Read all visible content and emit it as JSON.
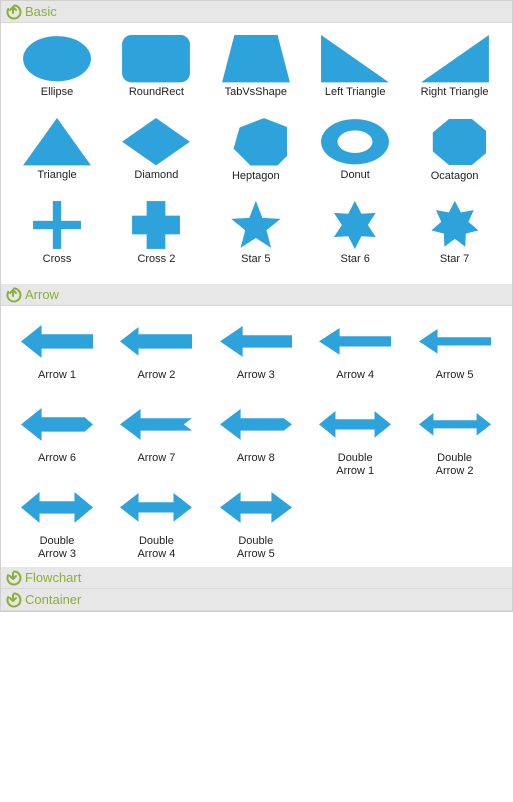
{
  "colors": {
    "shape_fill": "#2ea2da",
    "header_text": "#8bae3a",
    "header_bg": "#e7e7e7"
  },
  "sections": [
    {
      "id": "basic",
      "title": "Basic",
      "expanded": true,
      "items": [
        {
          "shape": "ellipse",
          "label": "Ellipse"
        },
        {
          "shape": "roundrect",
          "label": "RoundRect"
        },
        {
          "shape": "tabvshape",
          "label": "TabVsShape"
        },
        {
          "shape": "left-triangle",
          "label": "Left Triangle"
        },
        {
          "shape": "right-triangle",
          "label": "Right Triangle"
        },
        {
          "shape": "triangle",
          "label": "Triangle"
        },
        {
          "shape": "diamond",
          "label": "Diamond"
        },
        {
          "shape": "heptagon",
          "label": "Heptagon"
        },
        {
          "shape": "donut",
          "label": "Donut"
        },
        {
          "shape": "octagon",
          "label": "Ocatagon"
        },
        {
          "shape": "cross",
          "label": "Cross"
        },
        {
          "shape": "cross2",
          "label": "Cross 2"
        },
        {
          "shape": "star5",
          "label": "Star 5"
        },
        {
          "shape": "star6",
          "label": "Star 6"
        },
        {
          "shape": "star7",
          "label": "Star 7"
        }
      ]
    },
    {
      "id": "arrow",
      "title": "Arrow",
      "expanded": true,
      "items": [
        {
          "shape": "arrow1",
          "label": "Arrow 1"
        },
        {
          "shape": "arrow2",
          "label": "Arrow 2"
        },
        {
          "shape": "arrow3",
          "label": "Arrow 3"
        },
        {
          "shape": "arrow4",
          "label": "Arrow 4"
        },
        {
          "shape": "arrow5",
          "label": "Arrow 5"
        },
        {
          "shape": "arrow6",
          "label": "Arrow 6"
        },
        {
          "shape": "arrow7",
          "label": "Arrow 7"
        },
        {
          "shape": "arrow8",
          "label": "Arrow 8"
        },
        {
          "shape": "darrow1",
          "label": "Double\nArrow 1"
        },
        {
          "shape": "darrow2",
          "label": "Double\nArrow 2"
        },
        {
          "shape": "darrow3",
          "label": "Double\nArrow 3"
        },
        {
          "shape": "darrow4",
          "label": "Double\nArrow 4"
        },
        {
          "shape": "darrow5",
          "label": "Double\nArrow 5"
        }
      ]
    },
    {
      "id": "flowchart",
      "title": "Flowchart",
      "expanded": false,
      "items": []
    },
    {
      "id": "container",
      "title": "Container",
      "expanded": false,
      "items": []
    }
  ]
}
